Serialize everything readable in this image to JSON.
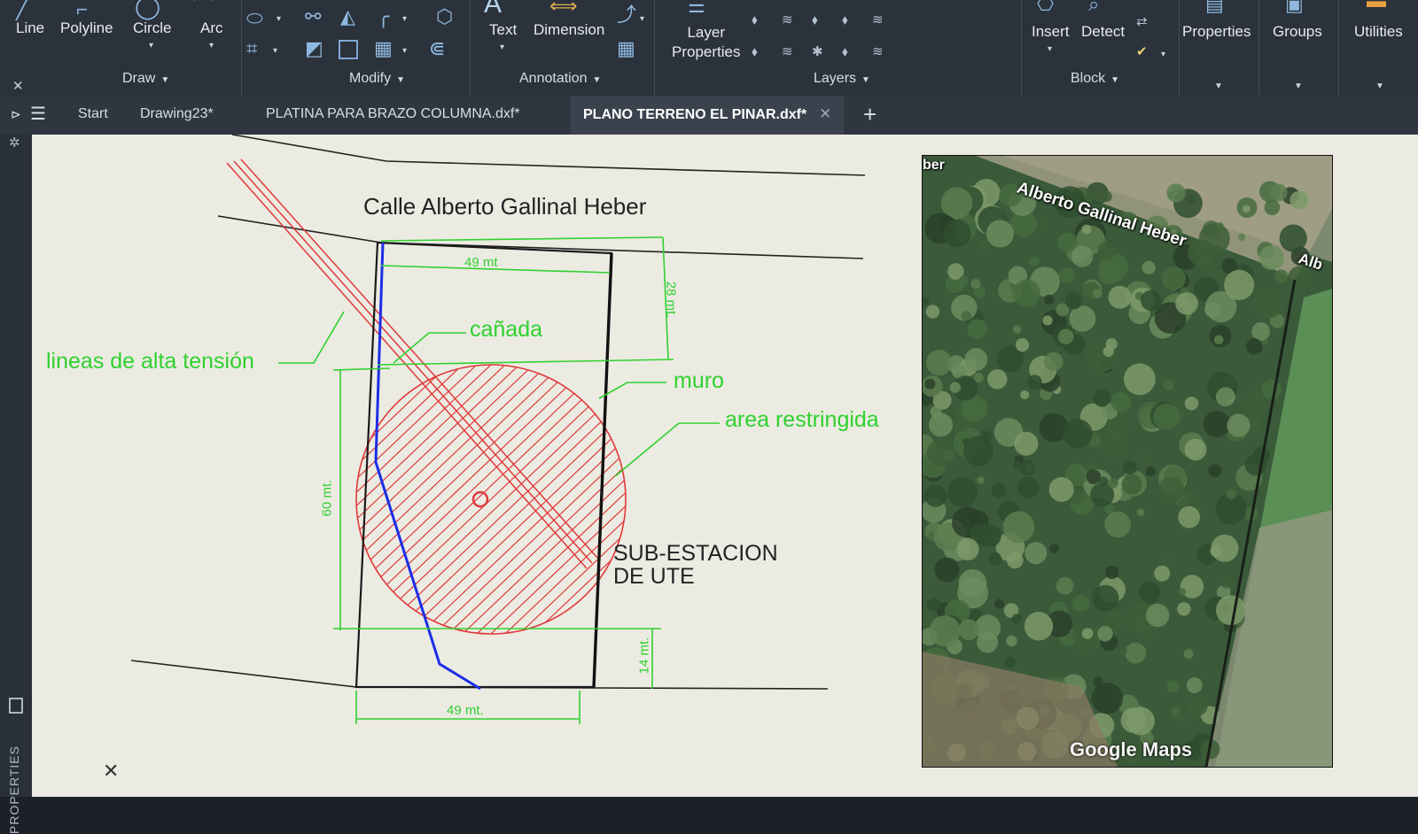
{
  "ribbon": {
    "draw": {
      "title": "Draw",
      "buttons": [
        {
          "label": "Line",
          "icon": "line-icon"
        },
        {
          "label": "Polyline",
          "icon": "polyline-icon"
        },
        {
          "label": "Circle",
          "icon": "circle-icon"
        },
        {
          "label": "Arc",
          "icon": "arc-icon"
        }
      ]
    },
    "modify": {
      "title": "Modify"
    },
    "annotation": {
      "title": "Annotation",
      "buttons": [
        {
          "label": "Text",
          "icon": "text-icon"
        },
        {
          "label": "Dimension",
          "icon": "dimension-icon"
        }
      ]
    },
    "layers": {
      "title": "Layers",
      "layer_properties_line1": "Layer",
      "layer_properties_line2": "Properties"
    },
    "block": {
      "title": "Block",
      "buttons": [
        {
          "label": "Insert",
          "icon": "insert-icon"
        },
        {
          "label": "Detect",
          "icon": "detect-icon"
        }
      ]
    },
    "properties": {
      "label": "Properties"
    },
    "groups": {
      "label": "Groups"
    },
    "utilities": {
      "label": "Utilities"
    }
  },
  "tabs": [
    {
      "label": "Start",
      "active": false
    },
    {
      "label": "Drawing23*",
      "active": false
    },
    {
      "label": "PLATINA PARA BRAZO COLUMNA.dxf*",
      "active": false
    },
    {
      "label": "PLANO TERRENO EL PINAR.dxf*",
      "active": true
    }
  ],
  "tab_close_symbol": "✕",
  "tab_add_symbol": "+",
  "properties_palette_label": "PROPERTIES",
  "drawing": {
    "street_name": "Calle Alberto Gallinal Heber",
    "labels": {
      "canada": "cañada",
      "high_voltage": "lineas de alta tensión",
      "wall": "muro",
      "restricted": "area restringida",
      "substation_line1": "SUB-ESTACION",
      "substation_line2": "DE UTE"
    },
    "dimensions": {
      "top_width": "49 mt",
      "top_depth": "28 mt.",
      "restricted_depth": "60 mt.",
      "bottom_depth": "14 mt.",
      "bottom_width": "49 mt."
    },
    "colors": {
      "dimension_green": "#2fd12f",
      "restricted_red": "#e0383a",
      "stream_blue": "#1b2ee8",
      "outline": "#1a1a1a"
    }
  },
  "map": {
    "road_label": "Alberto Gallinal Heber",
    "partial_top": "ber",
    "partial_right": "Alb",
    "brand": "Google Maps"
  }
}
